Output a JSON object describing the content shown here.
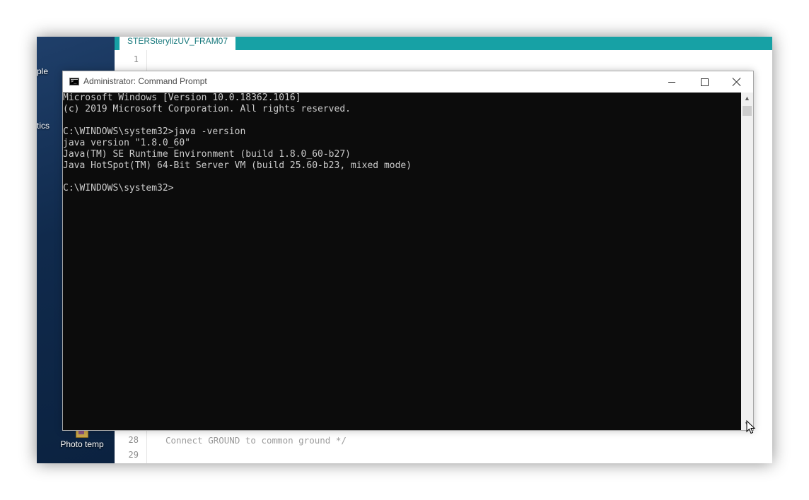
{
  "desktop": {
    "partial_labels": [
      "ple",
      "tics"
    ],
    "icon_label": "Photo temp"
  },
  "ide": {
    "tab_label": "STERSterylizUV_FRAM07",
    "line_numbers": [
      "1",
      "28",
      "29"
    ],
    "code_line_28": "Connect GROUND to common ground */"
  },
  "cmd": {
    "title": "Administrator: Command Prompt",
    "lines": [
      "Microsoft Windows [Version 10.0.18362.1016]",
      "(c) 2019 Microsoft Corporation. All rights reserved.",
      "",
      "C:\\WINDOWS\\system32>java -version",
      "java version \"1.8.0_60\"",
      "Java(TM) SE Runtime Environment (build 1.8.0_60-b27)",
      "Java HotSpot(TM) 64-Bit Server VM (build 25.60-b23, mixed mode)",
      "",
      "C:\\WINDOWS\\system32>"
    ]
  },
  "colors": {
    "ide_accent": "#17a1a5",
    "console_bg": "#0c0c0c",
    "console_text": "#cccccc"
  },
  "icons": {
    "cmd_app": "command-prompt-icon",
    "minimize": "minimize-icon",
    "maximize": "maximize-icon",
    "close": "close-icon",
    "scroll_up": "chevron-up-icon",
    "scroll_down": "chevron-down-icon",
    "pointer": "mouse-cursor-icon",
    "folder": "folder-icon"
  }
}
